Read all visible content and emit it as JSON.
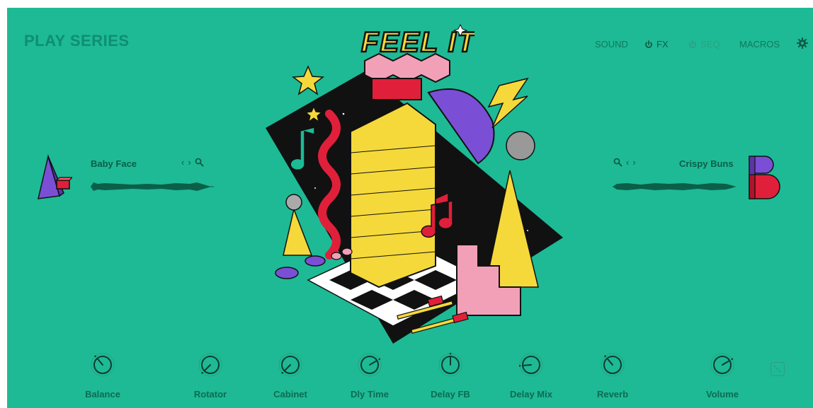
{
  "header": {
    "brand": "PLAY SERIES",
    "product_logo": "FEEL IT",
    "nav": [
      {
        "label": "SOUND",
        "power": false,
        "state": "normal"
      },
      {
        "label": "FX",
        "power": true,
        "state": "active"
      },
      {
        "label": "SEQ",
        "power": true,
        "state": "dim"
      },
      {
        "label": "MACROS",
        "power": false,
        "state": "normal"
      }
    ],
    "settings_icon": "gear-icon"
  },
  "layers": {
    "a": {
      "name": "Baby Face",
      "letter_icon": "layer-a-icon",
      "tools": [
        "chevron-left-icon",
        "chevron-right-icon",
        "search-icon"
      ]
    },
    "b": {
      "name": "Crispy Buns",
      "letter_icon": "layer-b-icon",
      "tools": [
        "search-icon",
        "chevron-left-icon",
        "chevron-right-icon"
      ]
    }
  },
  "knobs": [
    {
      "label": "Balance",
      "value": 0.35,
      "bipolar": false
    },
    {
      "label": "Rotator",
      "value": 0.0,
      "bipolar": false
    },
    {
      "label": "Cabinet",
      "value": 0.0,
      "bipolar": false
    },
    {
      "label": "Dly Time",
      "value": 0.72,
      "bipolar": false
    },
    {
      "label": "Delay FB",
      "value": 0.5,
      "bipolar": false
    },
    {
      "label": "Delay Mix",
      "value": 0.15,
      "bipolar": false
    },
    {
      "label": "Reverb",
      "value": 0.35,
      "bipolar": false
    },
    {
      "label": "Volume",
      "value": 0.72,
      "bipolar": false
    }
  ],
  "colors": {
    "background": "#1dba95",
    "accent_dark": "#0d5d49",
    "artwork_red": "#e0203a",
    "artwork_yellow": "#f5d93a",
    "artwork_purple": "#7a4fd6",
    "artwork_pink": "#f2a0b8"
  },
  "randomize_icon": "dice-icon"
}
